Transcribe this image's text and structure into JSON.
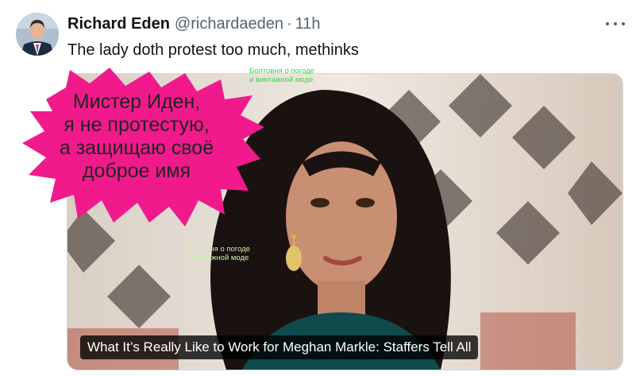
{
  "author": {
    "name": "Richard Eden",
    "handle": "@richardaeden",
    "separator": "·",
    "time": "11h"
  },
  "tweet": {
    "text": "The lady doth protest too much, methinks"
  },
  "media": {
    "caption": "What It’s Really Like to Work for Meghan Markle: Staffers Tell All"
  },
  "overlay": {
    "speech_lines": [
      "Мистер Иден,",
      "я не протестую,",
      "а защищаю своё",
      "доброе имя"
    ],
    "bubble_color": "#f01a8c"
  },
  "watermark": {
    "line1": "Болтовня о погоде",
    "line2": "и винтажной моде"
  },
  "icons": {
    "more": "more-dots-icon"
  }
}
